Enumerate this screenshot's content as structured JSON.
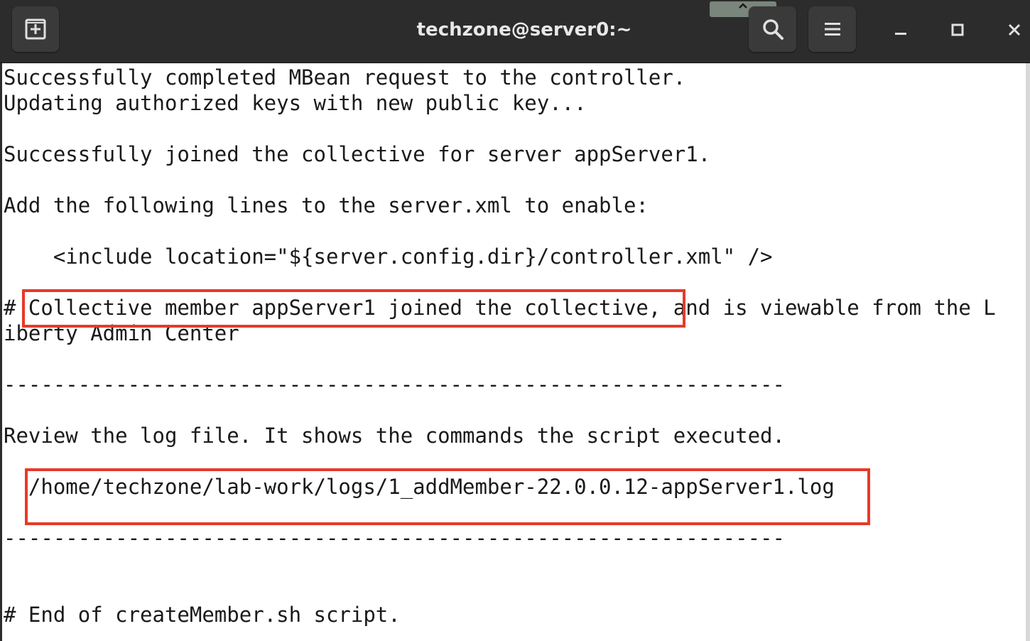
{
  "window": {
    "title": "techzone@server0:~"
  },
  "icons": {
    "new_tab": "new-tab-icon",
    "search": "search-icon",
    "menu": "hamburger-menu-icon",
    "collapse": "chevron-up-icon",
    "minimize": "minimize-icon",
    "maximize": "maximize-icon",
    "close": "close-icon"
  },
  "colors": {
    "titlebar": "#2c2c2c",
    "terminal_bg": "#ffffff",
    "terminal_fg": "#1a1a1a",
    "highlight": "#e63a28"
  },
  "terminal": {
    "lines": [
      "Successfully completed MBean request to the controller.",
      "Updating authorized keys with new public key...",
      "",
      "Successfully joined the collective for server appServer1.",
      "",
      "Add the following lines to the server.xml to enable:",
      "",
      "    <include location=\"${server.config.dir}/controller.xml\" />",
      "",
      "# Collective member appServer1 joined the collective, and is viewable from the L",
      "iberty Admin Center",
      "",
      "---------------------------------------------------------------",
      "",
      "Review the log file. It shows the commands the script executed.",
      "",
      "  /home/techzone/lab-work/logs/1_addMember-22.0.0.12-appServer1.log",
      "",
      "---------------------------------------------------------------",
      "",
      "",
      "# End of createMember.sh script."
    ]
  }
}
